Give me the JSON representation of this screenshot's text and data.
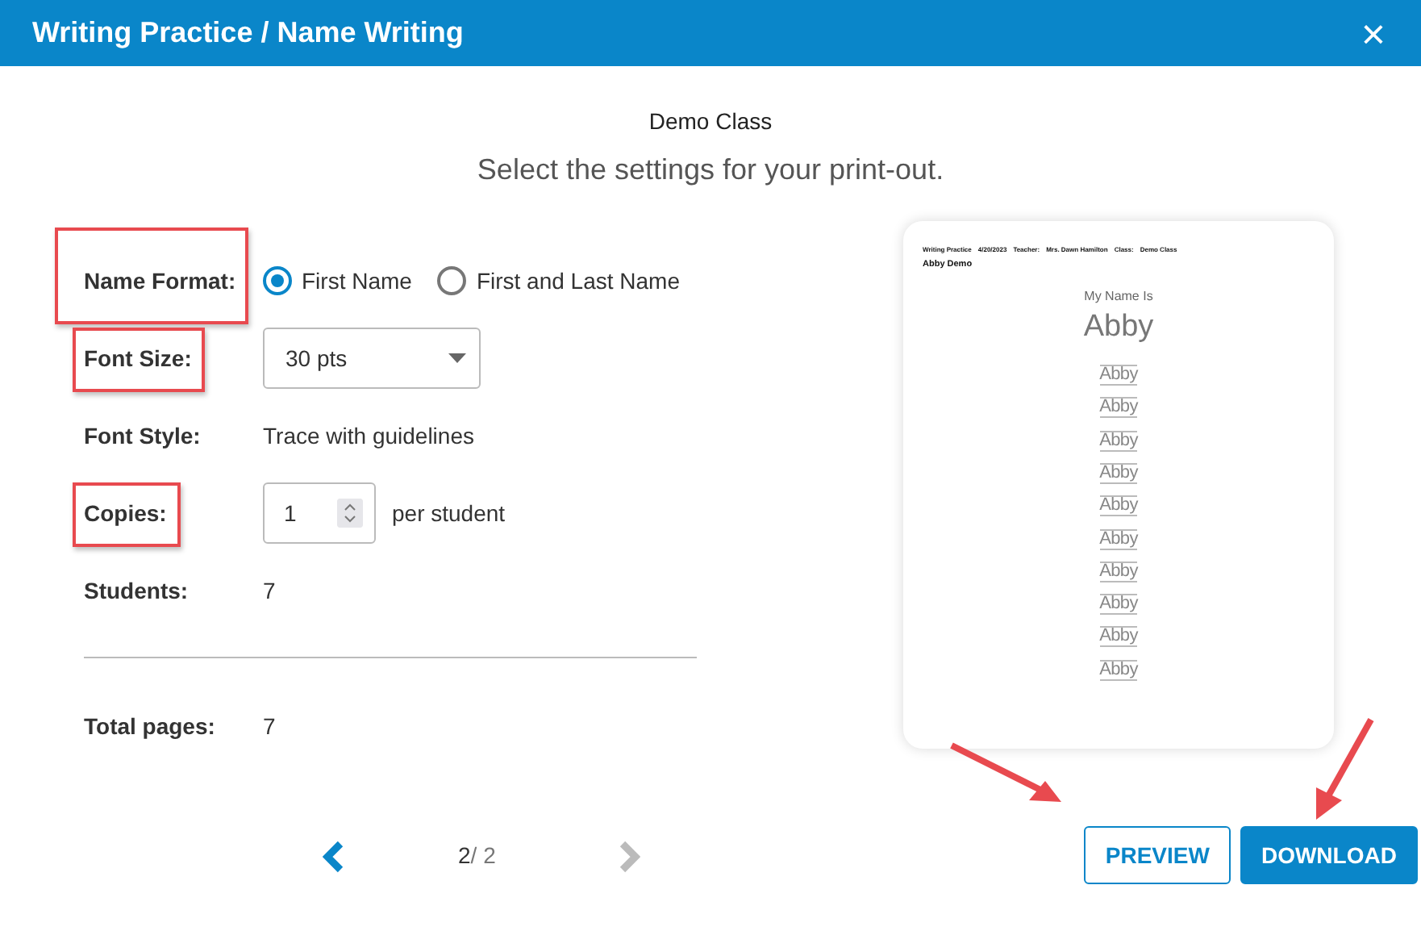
{
  "window": {
    "title": "Writing Practice / Name Writing",
    "close": "×"
  },
  "class_name": "Demo Class",
  "instruction": "Select the settings for your print-out.",
  "settings": [
    {
      "kind": "radio",
      "label": "Name Format:",
      "highlighted": true,
      "options": [
        {
          "label": "First Name",
          "selected": true
        },
        {
          "label": "First and Last Name",
          "selected": false
        }
      ]
    },
    {
      "kind": "select",
      "label": "Font Size:",
      "highlighted": true,
      "value": "30 pts"
    },
    {
      "kind": "text",
      "label": "Font Style:",
      "highlighted": false,
      "value": "Trace with guidelines"
    },
    {
      "kind": "number",
      "label": "Copies:",
      "highlighted": true,
      "value": "1",
      "suffix": "per student"
    },
    {
      "kind": "text",
      "label": "Students:",
      "highlighted": false,
      "value": "7"
    },
    {
      "kind": "divider"
    },
    {
      "kind": "text",
      "label": "Total pages:",
      "highlighted": false,
      "value": "7"
    }
  ],
  "preview": {
    "header": [
      "Writing Practice",
      "4/20/2023",
      "Teacher:",
      "Mrs. Dawn Hamilton",
      "Class:",
      "Demo Class"
    ],
    "student": "Abby Demo",
    "heading": "My Name Is",
    "name": "Abby",
    "trace_lines": [
      "Abby",
      "Abby",
      "Abby",
      "Abby",
      "Abby",
      "Abby",
      "Abby",
      "Abby",
      "Abby",
      "Abby"
    ]
  },
  "pager": {
    "current": "2",
    "total": "/ 2",
    "prev_disabled": false,
    "next_disabled": true
  },
  "buttons": [
    {
      "label": "PREVIEW",
      "kind": "outline",
      "annotated": true
    },
    {
      "label": "DOWNLOAD",
      "kind": "primary",
      "annotated": true
    }
  ]
}
